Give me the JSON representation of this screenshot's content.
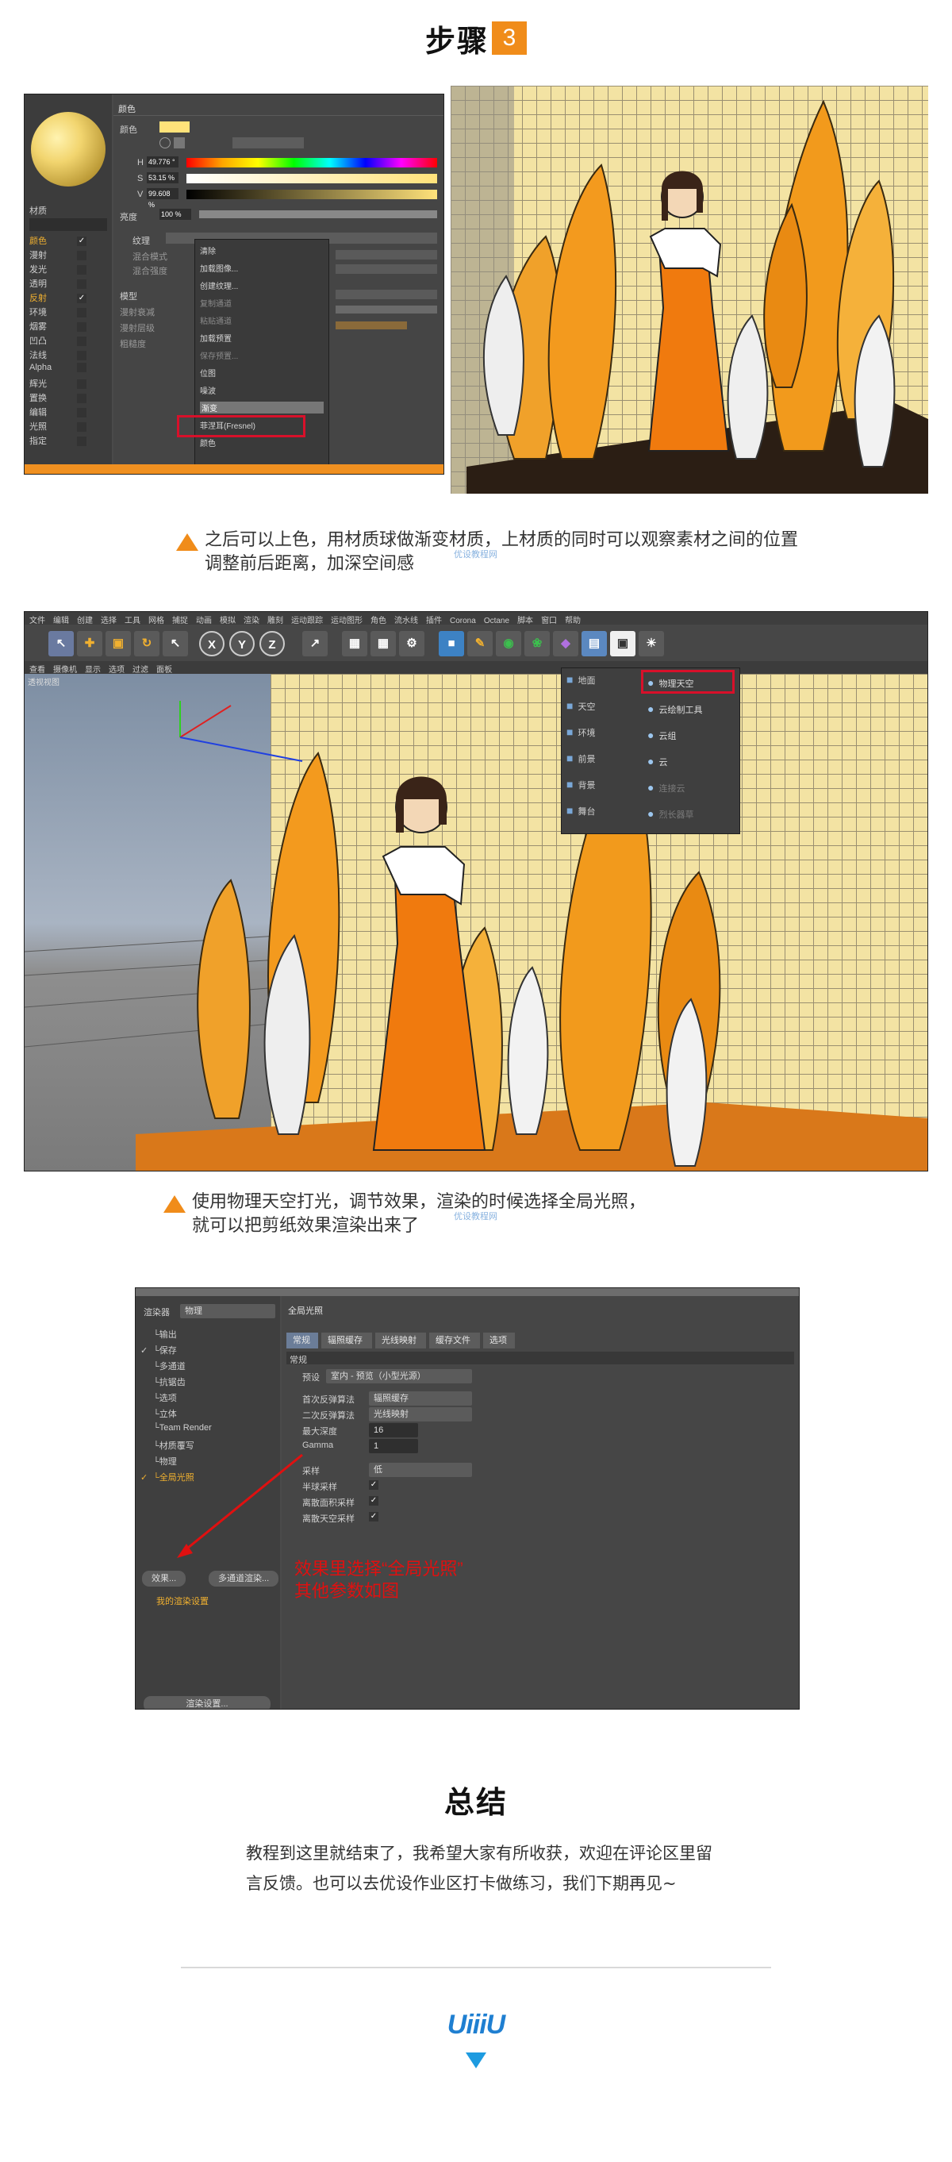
{
  "step": {
    "word": "步骤",
    "number": "3"
  },
  "material_editor": {
    "left_label": "材质",
    "channels": [
      {
        "name": "颜色",
        "checked": true
      },
      {
        "name": "漫射",
        "checked": false
      },
      {
        "name": "发光",
        "checked": false
      },
      {
        "name": "透明",
        "checked": false
      },
      {
        "name": "反射",
        "checked": true
      },
      {
        "name": "环境",
        "checked": false
      },
      {
        "name": "烟雾",
        "checked": false
      },
      {
        "name": "凹凸",
        "checked": false
      },
      {
        "name": "法线",
        "checked": false
      },
      {
        "name": "Alpha",
        "checked": false
      },
      {
        "name": "辉光",
        "checked": false
      },
      {
        "name": "置换",
        "checked": false
      },
      {
        "name": "编辑",
        "checked": false
      },
      {
        "name": "光照",
        "checked": false
      },
      {
        "name": "指定",
        "checked": false
      }
    ],
    "section_title": "颜色",
    "color_label": "颜色",
    "h_label": "H",
    "h_value": "49.776 °",
    "s_label": "S",
    "s_value": "53.15 %",
    "v_label": "V",
    "v_value": "99.608 %",
    "brightness_label": "亮度",
    "brightness_value": "100 %",
    "texture_label": "纹理",
    "mix_mode_label": "混合模式",
    "mix_strength_label": "混合强度",
    "model_label": "模型",
    "diffuse_falloff_label": "漫射衰减",
    "diffuse_level_label": "漫射层级",
    "roughness_label": "粗糙度",
    "menu_items": [
      "清除",
      "加载图像...",
      "创建纹理...",
      "复制通道",
      "粘贴通道",
      "加载预置",
      "保存预置...",
      "位图",
      "噪波",
      "渐变",
      "菲涅耳(Fresnel)",
      "颜色"
    ],
    "menu_highlight": "渐变"
  },
  "caption1": {
    "line1": "之后可以上色，用材质球做渐变材质，上材质的同时可以观察素材之间的位置",
    "line2": "调整前后距离，加深空间感",
    "watermark": "优设教程网"
  },
  "viewport": {
    "menubar": [
      "文件",
      "编辑",
      "创建",
      "选择",
      "工具",
      "网格",
      "捕捉",
      "动画",
      "模拟",
      "渲染",
      "雕刻",
      "运动跟踪",
      "运动图形",
      "角色",
      "流水线",
      "插件",
      "Corona",
      "Octane",
      "脚本",
      "窗口",
      "帮助"
    ],
    "submenu": [
      "查看",
      "摄像机",
      "显示",
      "选项",
      "过滤",
      "面板"
    ],
    "view_label": "透视视图",
    "tools": [
      "X",
      "Y",
      "Z"
    ],
    "sky_menu_left": [
      "地面",
      "天空",
      "环境",
      "前景",
      "背景",
      "舞台"
    ],
    "sky_menu_right": [
      "物理天空",
      "云绘制工具",
      "云组",
      "云",
      "连接云",
      "烈长器草"
    ],
    "sky_highlight": "物理天空"
  },
  "caption2": {
    "line1": "使用物理天空打光，调节效果，渲染的时候选择全局光照，",
    "line2": "就可以把剪纸效果渲染出来了",
    "watermark": "优设教程网"
  },
  "render_settings": {
    "renderer_label": "渲染器",
    "renderer_value": "物理",
    "items": [
      "输出",
      "保存",
      "多通道",
      "抗锯齿",
      "选项",
      "立体",
      "Team Render",
      "材质覆写",
      "物理",
      "全局光照"
    ],
    "checked_items": [
      false,
      true,
      false,
      false,
      false,
      false,
      false,
      false,
      false,
      true
    ],
    "effect_button": "效果...",
    "multipass_button": "多通道渲染...",
    "my_settings": "我的渲染设置",
    "render_setting_button": "渲染设置...",
    "panel_title": "全局光照",
    "tabs": [
      "常规",
      "辐照缓存",
      "光线映射",
      "缓存文件",
      "选项"
    ],
    "section": "常规",
    "preset_label": "预设",
    "preset_value": "室内 - 预览（小型光源）",
    "primary_label": "首次反弹算法",
    "primary_value": "辐照缓存",
    "secondary_label": "二次反弹算法",
    "secondary_value": "光线映射",
    "depth_label": "最大深度",
    "depth_value": "16",
    "gamma_label": "Gamma",
    "gamma_value": "1",
    "sampling_label": "采样",
    "sampling_value": "低",
    "hemisphere_label": "半球采样",
    "area_label": "离散面积采样",
    "sky_label": "离散天空采样",
    "note_line1": "效果里选择“全局光照”",
    "note_line2": "其他参数如图"
  },
  "summary": {
    "title": "总结",
    "body": "教程到这里就结束了，我希望大家有所收获，欢迎在评论区里留言反馈。也可以去优设作业区打卡做练习，我们下期再见~"
  },
  "logo": {
    "text": "UiiiU"
  },
  "colors": {
    "accent": "#f08c1a",
    "logo_blue": "#1f7fd1",
    "note_red": "#e01010"
  }
}
